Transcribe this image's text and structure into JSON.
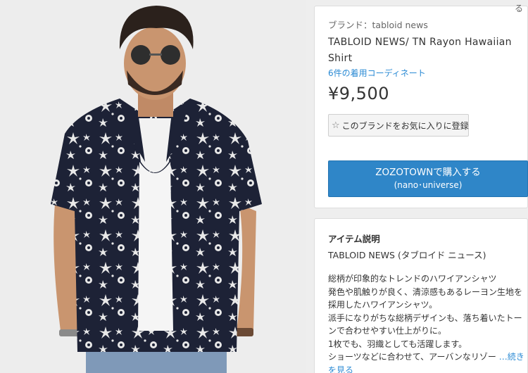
{
  "brand": {
    "label": "ブランド：",
    "name": "tabloid news"
  },
  "corner_char": "る",
  "product": {
    "title": "TABLOID NEWS/ TN Rayon Hawaiian Shirt",
    "coordinate_link": "6件の着用コーディネート",
    "price": "¥9,500"
  },
  "favorite_button": {
    "icon": "star-outline-icon",
    "label": "このブランドをお気に入りに登録"
  },
  "buy_button": {
    "line1": "ZOZOTOWNで購入する",
    "line2": "(nano･universe)"
  },
  "description": {
    "heading": "アイテム説明",
    "brand_line": "TABLOID NEWS (タブロイド ニュース)",
    "lines": [
      "総柄が印象的なトレンドのハワイアンシャツ",
      "発色や肌触りが良く、清涼感もあるレーヨン生地を",
      "採用したハワイアンシャツ。",
      "派手になりがちな総柄デザインも、落ち着いたトー",
      "ンで合わせやすい仕上がりに。",
      "1枚でも、羽織としても活躍します。"
    ],
    "last_line": "ショーツなどに合わせて、アーバンなリゾー",
    "more_link_part1": "…続き",
    "more_link_part2": "を見る"
  },
  "colors": {
    "accent_blue": "#2f86c8",
    "link_blue": "#2a8ad4",
    "shirt_navy": "#1d2236"
  }
}
